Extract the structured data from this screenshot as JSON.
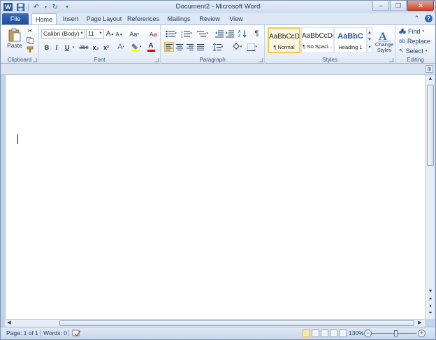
{
  "window": {
    "title": "Document2 - Microsoft Word"
  },
  "app": {
    "icon_label": "W"
  },
  "qat": {
    "save": "save-icon",
    "undo": "undo-icon",
    "redo": "redo-icon",
    "customize": "dropdown-icon"
  },
  "tabs": [
    {
      "label": "File"
    },
    {
      "label": "Home"
    },
    {
      "label": "Insert"
    },
    {
      "label": "Page Layout"
    },
    {
      "label": "References"
    },
    {
      "label": "Mailings"
    },
    {
      "label": "Review"
    },
    {
      "label": "View"
    }
  ],
  "ribbon": {
    "clipboard": {
      "label": "Clipboard",
      "paste": "Paste"
    },
    "font": {
      "label": "Font",
      "family": "Calibri (Body)",
      "size": "11",
      "grow": "A",
      "shrink": "A",
      "case": "Aa",
      "bold": "B",
      "italic": "I",
      "underline": "U",
      "strike": "abc",
      "subscript": "x₂",
      "superscript": "x²",
      "effects": "A",
      "color": "A"
    },
    "paragraph": {
      "label": "Paragraph"
    },
    "styles": {
      "label": "Styles",
      "items": [
        {
          "preview": "AaBbCcDc",
          "name": "¶ Normal"
        },
        {
          "preview": "AaBbCcDc",
          "name": "¶ No Spaci..."
        },
        {
          "preview": "AaBbC",
          "name": "Heading 1"
        }
      ],
      "change_label_1": "Change",
      "change_label_2": "Styles"
    },
    "editing": {
      "label": "Editing",
      "find": "Find",
      "replace": "Replace",
      "select": "Select"
    }
  },
  "status": {
    "page": "Page: 1 of 1",
    "words": "Words: 0",
    "zoom": "130%"
  },
  "colors": {
    "accent": "#2b579a",
    "ribbon_bg": "#dbe6f4",
    "file_tab": "#2a5ca8",
    "close_button": "#c7432b"
  }
}
